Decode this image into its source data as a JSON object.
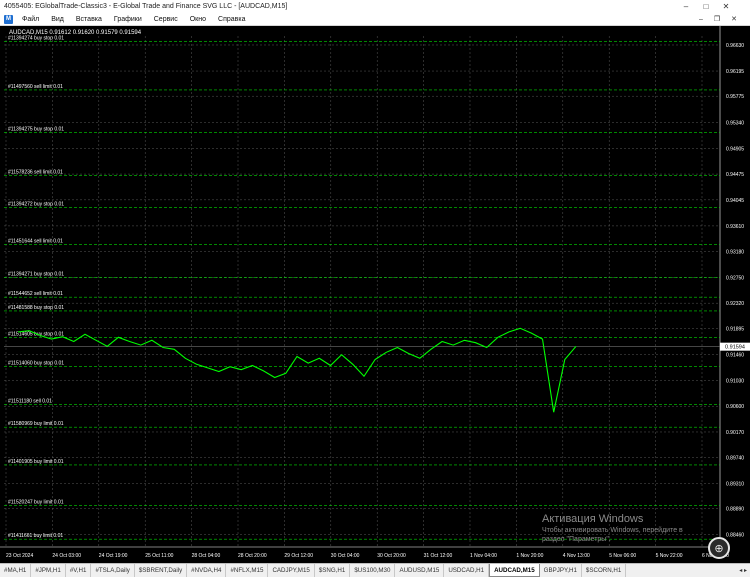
{
  "window": {
    "title": "4055405: EGlobalTrade-Classic3 - E-Global Trade and Finance SVG LLC - [AUDCAD,M15]",
    "minimize": "–",
    "maximize": "□",
    "close": "✕"
  },
  "menu": {
    "items": [
      "Файл",
      "Вид",
      "Вставка",
      "Графики",
      "Сервис",
      "Окно",
      "Справка"
    ],
    "minimize": "–",
    "restore": "❐",
    "close": "✕"
  },
  "chart": {
    "header": "AUDCAD,M15  0.91612 0.91620 0.91579 0.91594",
    "current_price": "0.91594",
    "line_color": "#00ff00",
    "order_line_color": "#00ff00"
  },
  "chart_data": {
    "type": "line",
    "title": "AUDCAD,M15",
    "ylim": [
      0.8825,
      0.9678
    ],
    "y_ticks": [
      "0.96630",
      "0.96195",
      "0.95775",
      "0.95340",
      "0.94905",
      "0.94475",
      "0.94045",
      "0.93610",
      "0.93180",
      "0.92750",
      "0.92320",
      "0.91895",
      "0.91460",
      "0.91030",
      "0.90600",
      "0.90170",
      "0.89740",
      "0.89310",
      "0.88890",
      "0.88460"
    ],
    "x_labels": [
      "23 Oct 2024",
      "24 Oct 03:00",
      "24 Oct 19:00",
      "25 Oct 11:00",
      "28 Oct 04:00",
      "28 Oct 20:00",
      "29 Oct 12:00",
      "30 Oct 04:00",
      "30 Oct 20:00",
      "31 Oct 12:00",
      "1 Nov 04:00",
      "1 Nov 20:00",
      "4 Nov 13:00",
      "5 Nov 06:00",
      "5 Nov 22:00",
      "6 Nov 14:00"
    ],
    "orders": [
      {
        "label": "#11394274 buy stop 0.01",
        "price": 0.9669
      },
      {
        "label": "#11497560 sell limit 0.01",
        "price": 0.9588
      },
      {
        "label": "#11394275 buy stop 0.01",
        "price": 0.9517
      },
      {
        "label": "#11578236 sell limit 0.01",
        "price": 0.9445
      },
      {
        "label": "#11394272 buy stop 0.01",
        "price": 0.9392
      },
      {
        "label": "#11451644 sell limit 0.01",
        "price": 0.933
      },
      {
        "label": "#11394271 buy stop 0.01",
        "price": 0.9275
      },
      {
        "label": "#11544652 sell limit 0.01",
        "price": 0.9242
      },
      {
        "label": "#11481588 buy stop 0.01",
        "price": 0.9219
      },
      {
        "label": "#11514605 buy stop 0.01",
        "price": 0.9175
      },
      {
        "label": "#11514060 buy stop 0.01",
        "price": 0.9126
      },
      {
        "label": "#11511180 sell 0.01",
        "price": 0.9063
      },
      {
        "label": "#11580969 buy limit 0.01",
        "price": 0.9025
      },
      {
        "label": "#11401905 buy limit 0.01",
        "price": 0.8962
      },
      {
        "label": "#11520247 buy limit 0.01",
        "price": 0.8894
      },
      {
        "label": "#11411661 buy limit 0.01",
        "price": 0.8838
      },
      {
        "label": "#11432049 buy limit 0.01",
        "price": 0.878
      }
    ],
    "series": [
      {
        "x": [
          0,
          2,
          4,
          6,
          8,
          10,
          12,
          14,
          16,
          18,
          20,
          22,
          24,
          26,
          28,
          30,
          32,
          34,
          36,
          38,
          40,
          42,
          44,
          46,
          48,
          50,
          52,
          54,
          56,
          58,
          60,
          62,
          64,
          66,
          68,
          70,
          72,
          74,
          76,
          78,
          80,
          82,
          84,
          86,
          88,
          90,
          92,
          94,
          96,
          98,
          100
        ],
        "y": [
          0.9184,
          0.9186,
          0.9178,
          0.9172,
          0.9176,
          0.9168,
          0.918,
          0.917,
          0.916,
          0.9175,
          0.9168,
          0.9162,
          0.917,
          0.9158,
          0.9155,
          0.914,
          0.913,
          0.9124,
          0.9118,
          0.9126,
          0.9121,
          0.9128,
          0.9119,
          0.9108,
          0.9115,
          0.9143,
          0.9132,
          0.914,
          0.9128,
          0.9146,
          0.913,
          0.911,
          0.9138,
          0.915,
          0.9158,
          0.9148,
          0.914,
          0.9155,
          0.9168,
          0.9162,
          0.917,
          0.9166,
          0.9158,
          0.9175,
          0.9184,
          0.919,
          0.9182,
          0.9172,
          0.905,
          0.9138,
          0.916
        ]
      }
    ]
  },
  "tabs": [
    "#MA,H1",
    "#JPM,H1",
    "#V,H1",
    "#TSLA,Daily",
    "$SBRENT,Daily",
    "#NVDA,H4",
    "#NFLX,M15",
    "CADJPY,M15",
    "$SNG,H1",
    "$US100,M30",
    "AUDUSD,M15",
    "USDCAD,H1",
    "AUDCAD,M15",
    "GBPJPY,H1",
    "$SCORN,H1"
  ],
  "active_tab": "AUDCAD,M15",
  "watermark": {
    "title": "Активация Windows",
    "line1": "Чтобы активировать Windows, перейдите в",
    "line2": "раздел \"Параметры\"."
  }
}
